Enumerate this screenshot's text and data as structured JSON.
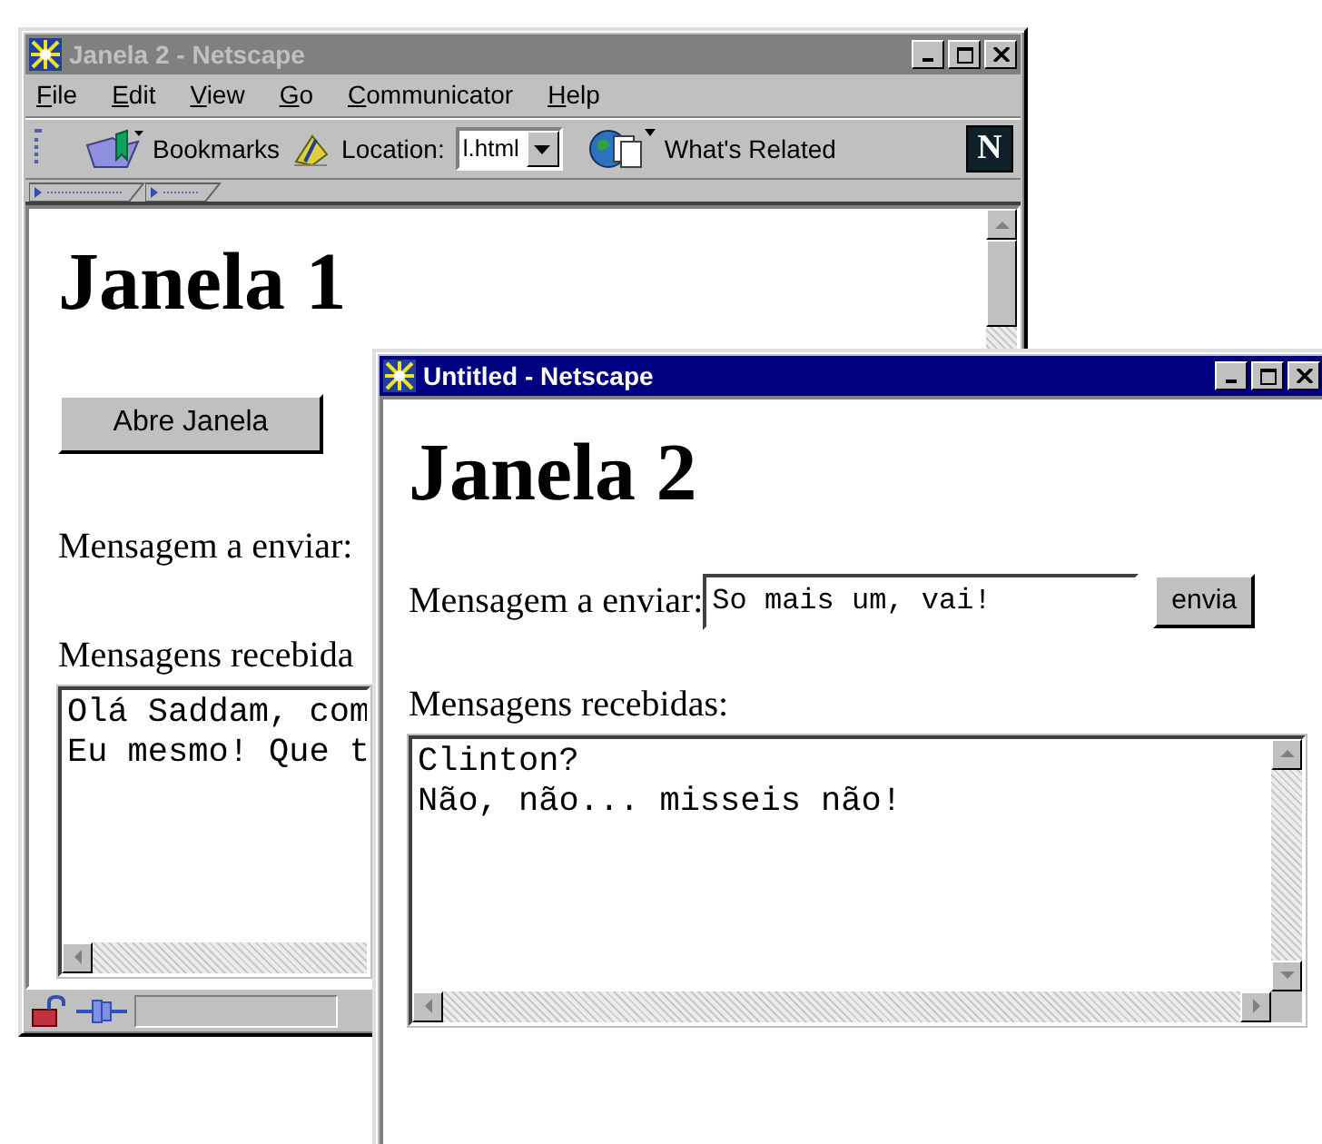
{
  "windows": [
    {
      "title": "Janela 2 - Netscape",
      "active": false,
      "menu": [
        {
          "label": "File"
        },
        {
          "label": "Edit"
        },
        {
          "label": "View"
        },
        {
          "label": "Go"
        },
        {
          "label": "Communicator"
        },
        {
          "label": "Help"
        }
      ],
      "toolbar": {
        "bookmarks": "Bookmarks",
        "location_label": "Location:",
        "location_value": "l.html",
        "whats_related": "What's Related",
        "logo_letter": "N"
      },
      "page": {
        "heading": "Janela 1",
        "button": "Abre Janela",
        "send_label": "Mensagem a enviar:",
        "received_label": "Mensagens recebida",
        "received_lines": [
          "Olá Saddam, com",
          "Eu mesmo! Que t"
        ]
      }
    },
    {
      "title": "Untitled - Netscape",
      "active": true,
      "page": {
        "heading": "Janela 2",
        "send_label": "Mensagem a enviar:",
        "message_value": "So mais um, vai!",
        "send_button": "envia",
        "received_label": "Mensagens recebidas:",
        "received_lines": [
          "Clinton?",
          "Não, não... misseis não!"
        ]
      }
    }
  ]
}
